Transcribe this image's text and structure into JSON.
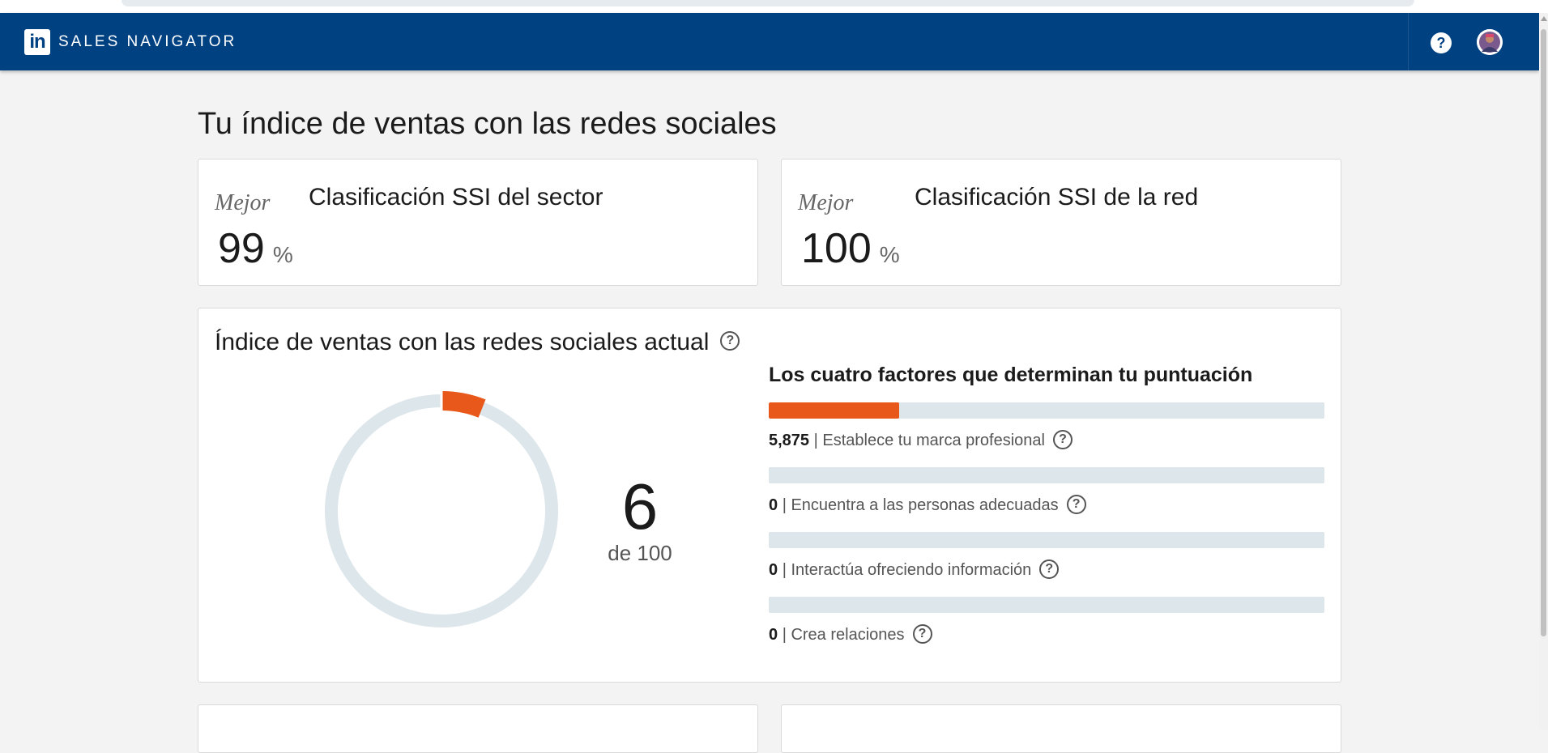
{
  "app": {
    "brand_logo": "in",
    "brand_name": "SALES NAVIGATOR",
    "help_icon": "help-icon",
    "avatar_icon": "user-avatar"
  },
  "page": {
    "title": "Tu índice de ventas con las redes sociales"
  },
  "rankings": [
    {
      "qualifier": "Mejor",
      "label": "Clasificación SSI del sector",
      "value": "99",
      "unit": "%"
    },
    {
      "qualifier": "Mejor",
      "label": "Clasificación SSI de la red",
      "value": "100",
      "unit": "%"
    }
  ],
  "ssi": {
    "title": "Índice de ventas con las redes sociales actual",
    "help_glyph": "?",
    "score": "6",
    "score_of": "de 100",
    "score_value": 6,
    "score_max": 100,
    "colors": {
      "accent": "#e8581a",
      "track": "#dde6eb",
      "nav": "#004182"
    },
    "factors_title": "Los cuatro factores que determinan tu puntuación",
    "factors": [
      {
        "value": "5,875",
        "label": "Establece tu marca profesional",
        "fill_fraction": 0.235
      },
      {
        "value": "0",
        "label": "Encuentra a las personas adecuadas",
        "fill_fraction": 0
      },
      {
        "value": "0",
        "label": "Interactúa ofreciendo información",
        "fill_fraction": 0
      },
      {
        "value": "0",
        "label": "Crea relaciones",
        "fill_fraction": 0
      }
    ]
  },
  "separator": "|"
}
